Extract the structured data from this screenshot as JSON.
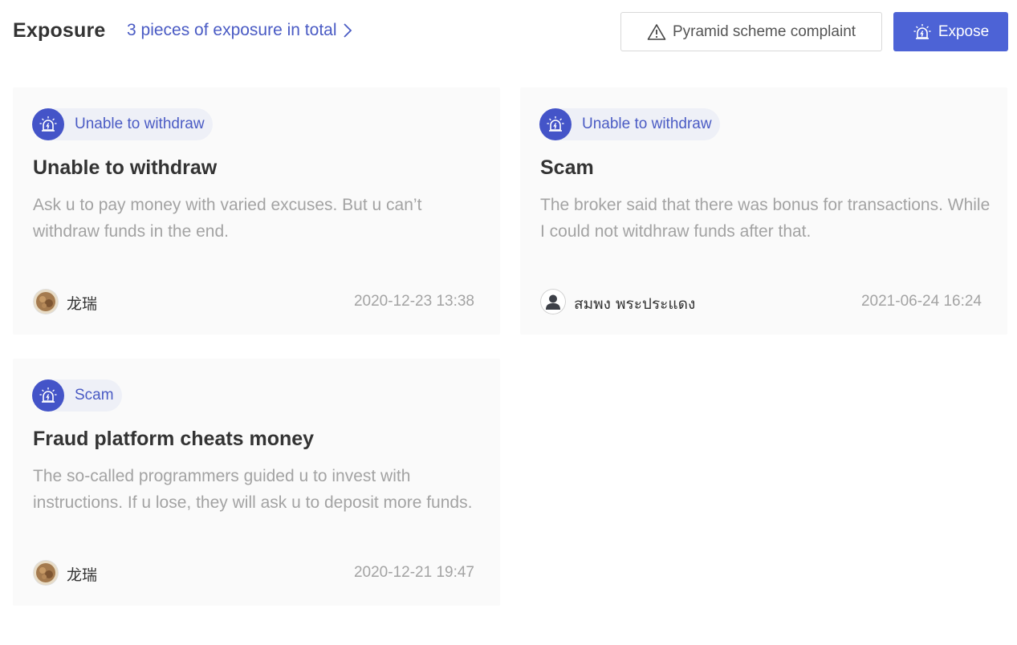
{
  "header": {
    "title": "Exposure",
    "total_link": "3 pieces of exposure in total",
    "complaint_button": "Pyramid scheme complaint",
    "expose_button": "Expose"
  },
  "cards": [
    {
      "tag": "Unable to withdraw",
      "title": "Unable to withdraw",
      "description": "Ask u to pay money with varied excuses. But u can’t withdraw funds in the end.",
      "author": "龙瑞",
      "date": "2020-12-23 13:38",
      "avatar": "photo-avatar"
    },
    {
      "tag": "Unable to withdraw",
      "title": "Scam",
      "description": "The broker said that there was bonus for transactions. While I could not witdhraw funds after that.",
      "author": "สมพง พระประแดง",
      "date": "2021-06-24 16:24",
      "avatar": "default-user-avatar"
    },
    {
      "tag": "Scam",
      "title": "Fraud platform cheats money",
      "description": "The so-called programmers guided u to invest with instructions. If u lose, they will ask u to deposit more funds.",
      "author": "龙瑞",
      "date": "2020-12-21 19:47",
      "avatar": "photo-avatar"
    }
  ],
  "colors": {
    "accent": "#4d63d6",
    "link": "#4a5bc4",
    "muted": "#a3a3a3"
  }
}
